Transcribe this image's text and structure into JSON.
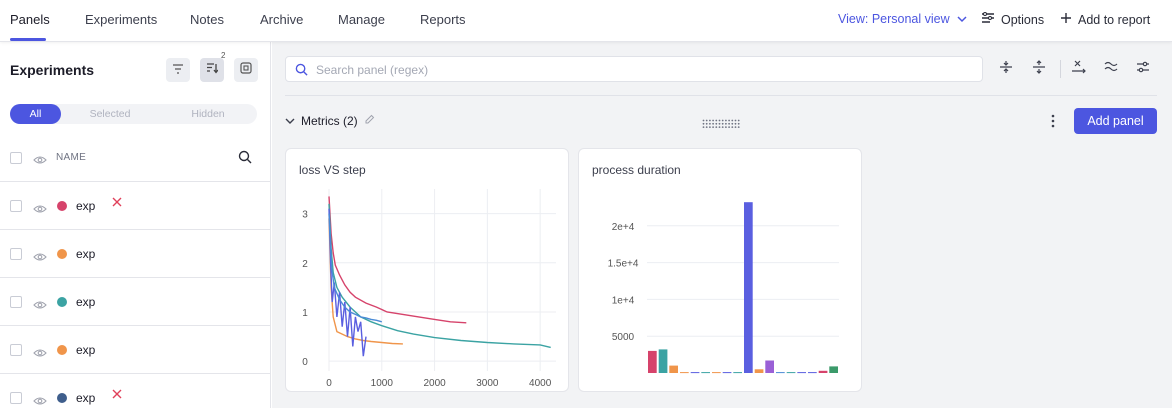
{
  "nav": {
    "tabs": [
      {
        "label": "Panels",
        "active": true
      },
      {
        "label": "Experiments",
        "active": false
      },
      {
        "label": "Notes",
        "active": false
      },
      {
        "label": "Archive",
        "active": false
      },
      {
        "label": "Manage",
        "active": false
      },
      {
        "label": "Reports",
        "active": false
      }
    ],
    "view_prefix": "View: ",
    "view_value": "Personal view",
    "options_label": "Options",
    "add_to_report_label": "Add to report"
  },
  "sidebar": {
    "title": "Experiments",
    "sort_badge": "2",
    "filter_tabs": [
      "All",
      "Selected",
      "Hidden"
    ],
    "active_filter": "All",
    "name_header": "NAME",
    "experiments": [
      {
        "name": "exp",
        "color": "#d6436b",
        "removable": true
      },
      {
        "name": "exp",
        "color": "#f0954a",
        "removable": false
      },
      {
        "name": "exp",
        "color": "#3ba3a3",
        "removable": false
      },
      {
        "name": "exp",
        "color": "#f0954a",
        "removable": false
      },
      {
        "name": "exp",
        "color": "#3f5e8c",
        "removable": true
      }
    ]
  },
  "main": {
    "search_placeholder": "Search panel (regex)",
    "section_title": "Metrics (2)",
    "add_panel_label": "Add panel"
  },
  "colors": {
    "accent": "#4c56e0",
    "remove": "#e0405a"
  },
  "chart_data": [
    {
      "type": "line",
      "title": "loss VS step",
      "xlabel": "",
      "ylabel": "",
      "xlim": [
        0,
        4300
      ],
      "ylim": [
        -0.2,
        3.5
      ],
      "xticks": [
        0,
        1000,
        2000,
        3000,
        4000
      ],
      "yticks": [
        0,
        1,
        2,
        3
      ],
      "grid": true,
      "series": [
        {
          "color": "#d6436b",
          "x": [
            0,
            40,
            80,
            120,
            200,
            300,
            400,
            500,
            700,
            900,
            1100,
            1400,
            1700,
            2000,
            2300,
            2600
          ],
          "y": [
            3.35,
            2.6,
            2.2,
            1.95,
            1.75,
            1.55,
            1.4,
            1.3,
            1.18,
            1.1,
            1.0,
            0.95,
            0.9,
            0.85,
            0.8,
            0.78
          ]
        },
        {
          "color": "#3ba3a3",
          "x": [
            0,
            40,
            80,
            150,
            250,
            400,
            600,
            800,
            1000,
            1300,
            1600,
            2000,
            2500,
            3000,
            3500,
            4000,
            4200
          ],
          "y": [
            3.2,
            2.3,
            1.8,
            1.5,
            1.3,
            1.1,
            0.9,
            0.8,
            0.72,
            0.62,
            0.55,
            0.48,
            0.42,
            0.38,
            0.35,
            0.33,
            0.28
          ]
        },
        {
          "color": "#f0954a",
          "x": [
            0,
            40,
            80,
            150,
            250,
            350,
            500,
            650,
            800,
            1000,
            1200,
            1400
          ],
          "y": [
            2.9,
            1.5,
            0.9,
            0.6,
            0.55,
            0.5,
            0.45,
            0.42,
            0.4,
            0.38,
            0.36,
            0.35
          ]
        },
        {
          "color": "#5a5fe0",
          "x": [
            0,
            30,
            60,
            100,
            150,
            200,
            250,
            300,
            350,
            400,
            450,
            500,
            550,
            600,
            650,
            700
          ],
          "y": [
            3.1,
            2.0,
            1.2,
            1.6,
            0.9,
            1.4,
            0.7,
            1.2,
            0.5,
            1.1,
            0.3,
            0.9,
            0.6,
            0.8,
            0.1,
            0.5
          ]
        },
        {
          "color": "#4a8ad6",
          "x": [
            0,
            50,
            100,
            200,
            300,
            400,
            500,
            600,
            700,
            800,
            900,
            1000
          ],
          "y": [
            3.0,
            1.9,
            1.5,
            1.25,
            1.1,
            1.0,
            0.95,
            0.9,
            0.88,
            0.85,
            0.83,
            0.8
          ]
        }
      ]
    },
    {
      "type": "bar",
      "title": "process duration",
      "xlabel": "",
      "ylabel": "",
      "ylim": [
        0,
        25000
      ],
      "yticks": [
        5000,
        10000,
        15000,
        20000
      ],
      "ytick_labels": [
        "5000",
        "1e+4",
        "1.5e+4",
        "2e+4"
      ],
      "grid": true,
      "bars": [
        {
          "value": 3000,
          "color": "#d6436b"
        },
        {
          "value": 3200,
          "color": "#3ba3a3"
        },
        {
          "value": 1000,
          "color": "#f0954a"
        },
        {
          "value": 120,
          "color": "#f0954a"
        },
        {
          "value": 120,
          "color": "#5a5fe0"
        },
        {
          "value": 120,
          "color": "#3ba3a3"
        },
        {
          "value": 120,
          "color": "#f0954a"
        },
        {
          "value": 120,
          "color": "#5a5fe0"
        },
        {
          "value": 120,
          "color": "#3ba3a3"
        },
        {
          "value": 23200,
          "color": "#5a5fe0"
        },
        {
          "value": 500,
          "color": "#f0954a"
        },
        {
          "value": 1700,
          "color": "#9a60d6"
        },
        {
          "value": 120,
          "color": "#4a8ad6"
        },
        {
          "value": 120,
          "color": "#3ba3a3"
        },
        {
          "value": 120,
          "color": "#5a5fe0"
        },
        {
          "value": 120,
          "color": "#5a5fe0"
        },
        {
          "value": 300,
          "color": "#d6436b"
        },
        {
          "value": 900,
          "color": "#3b9a6a"
        }
      ]
    }
  ]
}
